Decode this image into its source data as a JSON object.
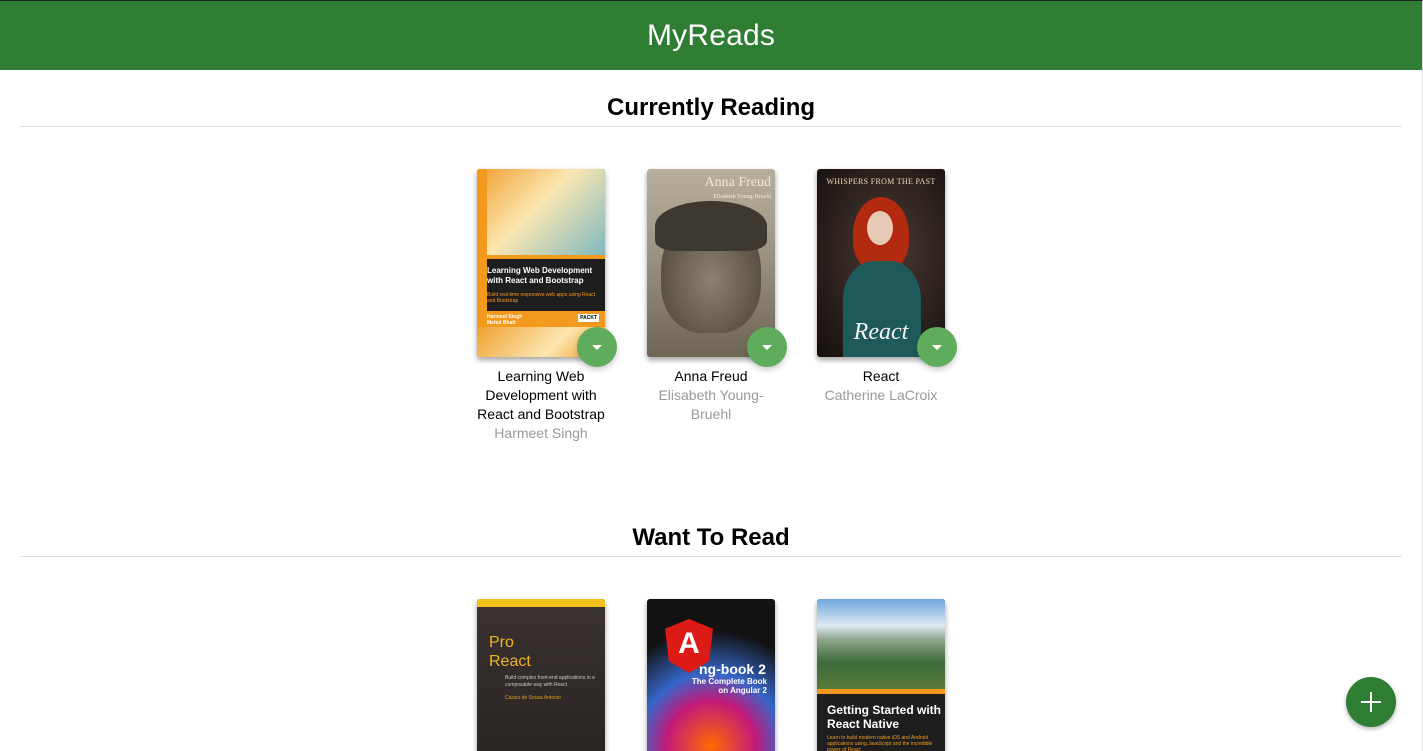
{
  "app": {
    "title": "MyReads"
  },
  "shelves": [
    {
      "title": "Currently Reading",
      "books": [
        {
          "title": "Learning Web Development with React and Bootstrap",
          "authors": "Harmeet Singh",
          "cover": {
            "title": "Learning Web Development with React and Bootstrap",
            "subtitle": "Build real-time responsive web apps using React and Bootstrap",
            "authors": "Harmeet Singh\nMehul Bhatt",
            "publisher": "PACKT"
          }
        },
        {
          "title": "Anna Freud",
          "authors": "Elisabeth Young-Bruehl",
          "cover": {
            "title": "Anna Freud",
            "authors": "Elisabeth Young-Bruehl"
          }
        },
        {
          "title": "React",
          "authors": "Catherine LaCroix",
          "cover": {
            "title": "Whispers from the Past",
            "script": "React"
          }
        }
      ]
    },
    {
      "title": "Want To Read",
      "books": [
        {
          "cover": {
            "title": "Pro\nReact",
            "subtitle": "Build complex front-end applications in a composable way with React",
            "authors": "Cássio de Sousa Antonio"
          }
        },
        {
          "cover": {
            "logo": "A",
            "title": "ng-book 2",
            "subtitle": "The Complete Book on Angular 2"
          }
        },
        {
          "cover": {
            "title": "Getting Started with React Native",
            "subtitle": "Learn to build modern native iOS and Android applications using JavaScript and the incredible power of React"
          }
        }
      ]
    }
  ],
  "icons": {
    "shelf_changer": "caret-down-icon",
    "add": "plus-icon"
  },
  "colors": {
    "header": "#2e7d32",
    "changer": "#60ac5d",
    "add_button": "#2e7d32",
    "author_text": "#999999"
  }
}
